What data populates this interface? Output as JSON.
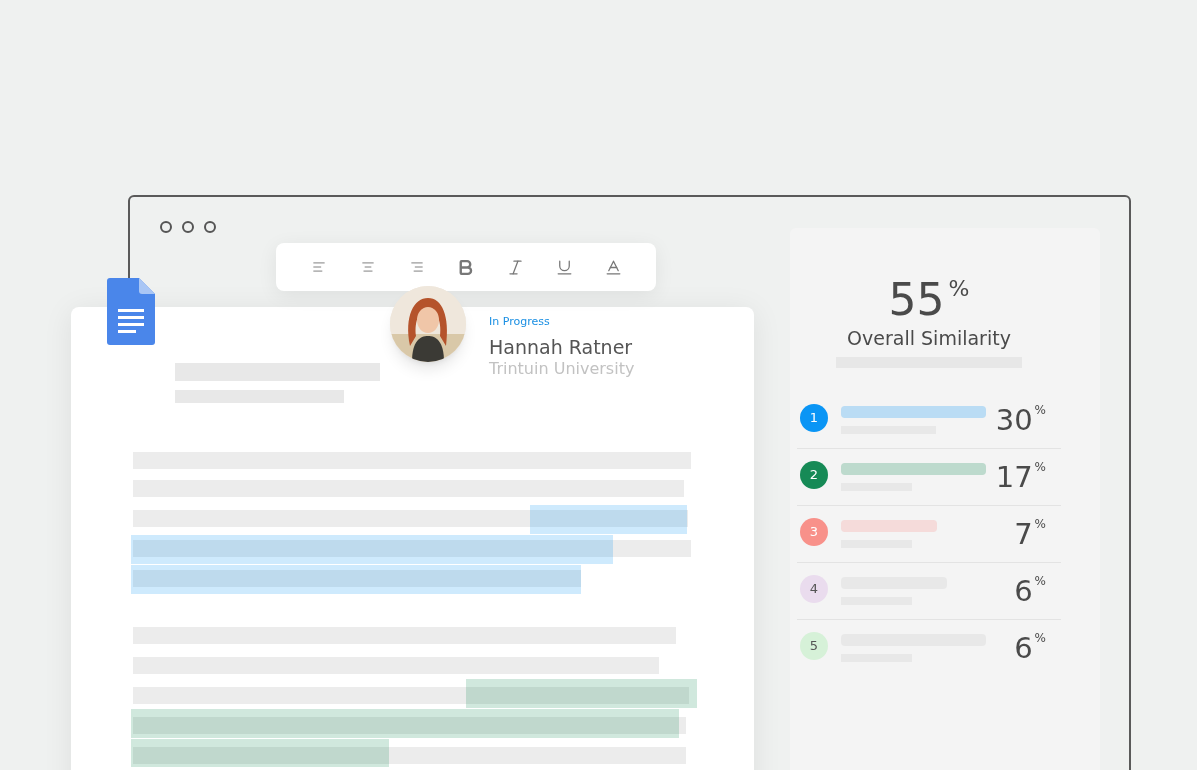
{
  "author": {
    "status": "In Progress",
    "name": "Hannah Ratner",
    "institution": "Trintuin University"
  },
  "similarity": {
    "value": "55",
    "unit": "%",
    "label": "Overall Similarity"
  },
  "sources": [
    {
      "number": "1",
      "color": "#0a95f5",
      "highlighted": true,
      "value": "30",
      "unit": "%"
    },
    {
      "number": "2",
      "color": "#168a56",
      "highlighted": true,
      "value": "17",
      "unit": "%"
    },
    {
      "number": "3",
      "color": "#f8918a",
      "highlighted": true,
      "value": "7",
      "unit": "%"
    },
    {
      "number": "4",
      "color": "#eadcee",
      "highlighted": false,
      "value": "6",
      "unit": "%"
    },
    {
      "number": "5",
      "color": "#d6f1d8",
      "highlighted": false,
      "value": "6",
      "unit": "%"
    }
  ]
}
